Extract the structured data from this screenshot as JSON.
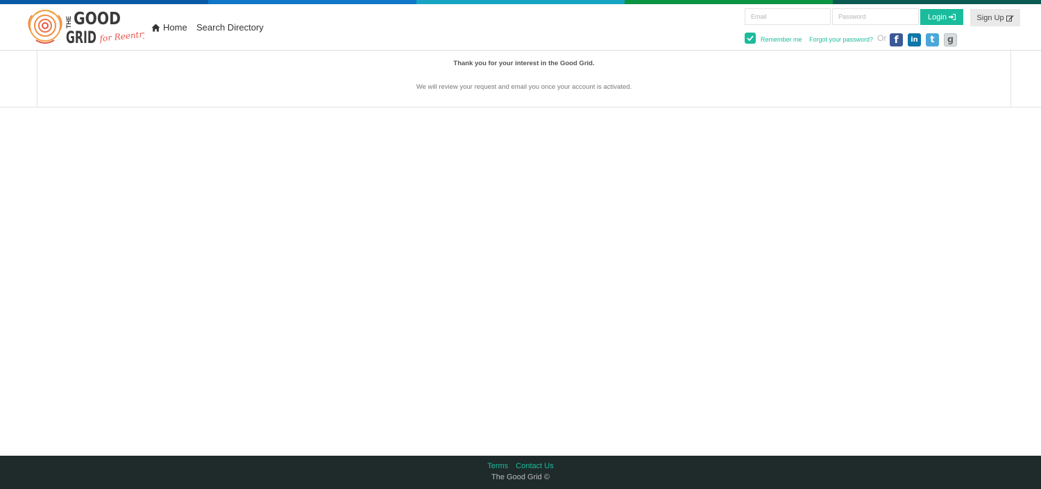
{
  "brand": {
    "logo_line1": "THE",
    "logo_line2": "GOOD",
    "logo_line3": "GRID",
    "logo_tagline": "for Reentry"
  },
  "top_bar_colors": [
    "#0a5aa6",
    "#0e77c9",
    "#17a3c2",
    "#0c9445",
    "#0a5a52"
  ],
  "nav": {
    "home": "Home",
    "search_directory": "Search Directory"
  },
  "login": {
    "email_placeholder": "Email",
    "password_placeholder": "Password",
    "login_label": "Login",
    "signup_label": "Sign Up",
    "remember_me": "Remember me",
    "remember_checked": true,
    "forgot_password": "Forgot your password?",
    "or": "Or"
  },
  "social": [
    {
      "name": "facebook",
      "glyph": "f",
      "color": "#3b5998"
    },
    {
      "name": "linkedin",
      "glyph": "in",
      "color": "#0e76a8"
    },
    {
      "name": "twitter",
      "glyph": "t",
      "color": "#4aa7d8"
    },
    {
      "name": "google",
      "glyph": "g",
      "color": "#d7dcdf"
    }
  ],
  "message": {
    "thanks": "Thank you for your interest in the Good Grid.",
    "review": "We will review your request and email you once your account is activated."
  },
  "footer": {
    "terms": "Terms",
    "contact": "Contact Us",
    "copyright": "The Good Grid ©"
  },
  "colors": {
    "accent": "#1abc9c",
    "footer_bg": "#1f2b2b",
    "logo_dark": "#3a3a3a",
    "logo_orange": "#f1a34a",
    "logo_red": "#e5524a"
  }
}
